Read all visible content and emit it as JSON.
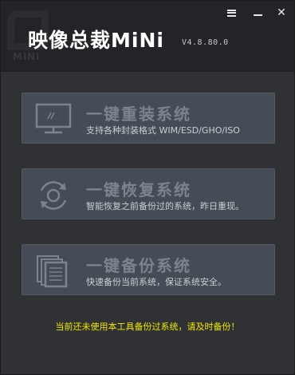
{
  "app": {
    "title": "映像总裁MiNi",
    "version": "V4.8.80.0",
    "watermark": "MiNi"
  },
  "window_controls": {
    "menu_icon": "hamburger-menu-icon",
    "minimize_icon": "minimize-icon",
    "close_icon": "close-icon",
    "close_glyph": "✕"
  },
  "actions": [
    {
      "icon": "monitor-icon",
      "title": "一键重装系统",
      "subtitle": "支持各种封装格式 WIM/ESD/GHO/ISO"
    },
    {
      "icon": "restore-arrows-icon",
      "title": "一键恢复系统",
      "subtitle": "智能恢复之前备份过的系统，昨日重现。"
    },
    {
      "icon": "backup-documents-icon",
      "title": "一键备份系统",
      "subtitle": "快速备份当前系统，保证系统安全。"
    }
  ],
  "notice": "当前还未使用本工具备份过系统，请及时备份！",
  "colors": {
    "background": "#2f3135",
    "header": "#232427",
    "panel": "#464c55",
    "panel_title": "#7c838c",
    "notice": "#f2e600"
  }
}
